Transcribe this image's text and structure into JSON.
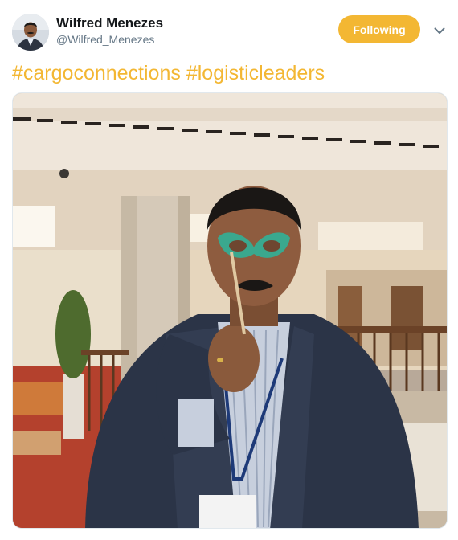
{
  "author": {
    "display_name": "Wilfred Menezes",
    "handle": "@Wilfred_Menezes"
  },
  "follow_button": {
    "label": "Following"
  },
  "tweet": {
    "hashtags": [
      "#cargoconnections",
      "#logisticleaders"
    ]
  },
  "colors": {
    "accent": "#f3b733",
    "name": "#14171a",
    "secondary": "#657786"
  },
  "icons": {
    "menu": "chevron-down-icon"
  }
}
